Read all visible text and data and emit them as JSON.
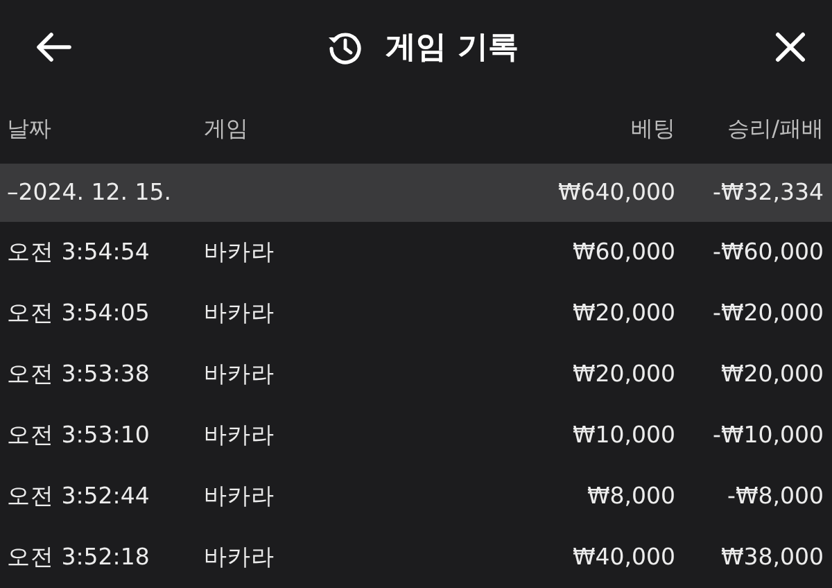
{
  "header": {
    "title": "게임 기록"
  },
  "table": {
    "columns": [
      "날짜",
      "게임",
      "베팅",
      "승리/패배"
    ],
    "groups": [
      {
        "label": "–2024. 12. 15.",
        "bet": "₩640,000",
        "result": "-₩32,334",
        "rows": [
          {
            "time": "오전 3:54:54",
            "game": "바카라",
            "bet": "₩60,000",
            "result": "-₩60,000"
          },
          {
            "time": "오전 3:54:05",
            "game": "바카라",
            "bet": "₩20,000",
            "result": "-₩20,000"
          },
          {
            "time": "오전 3:53:38",
            "game": "바카라",
            "bet": "₩20,000",
            "result": "₩20,000"
          },
          {
            "time": "오전 3:53:10",
            "game": "바카라",
            "bet": "₩10,000",
            "result": "-₩10,000"
          },
          {
            "time": "오전 3:52:44",
            "game": "바카라",
            "bet": "₩8,000",
            "result": "-₩8,000"
          },
          {
            "time": "오전 3:52:18",
            "game": "바카라",
            "bet": "₩40,000",
            "result": "₩38,000"
          }
        ]
      }
    ]
  }
}
